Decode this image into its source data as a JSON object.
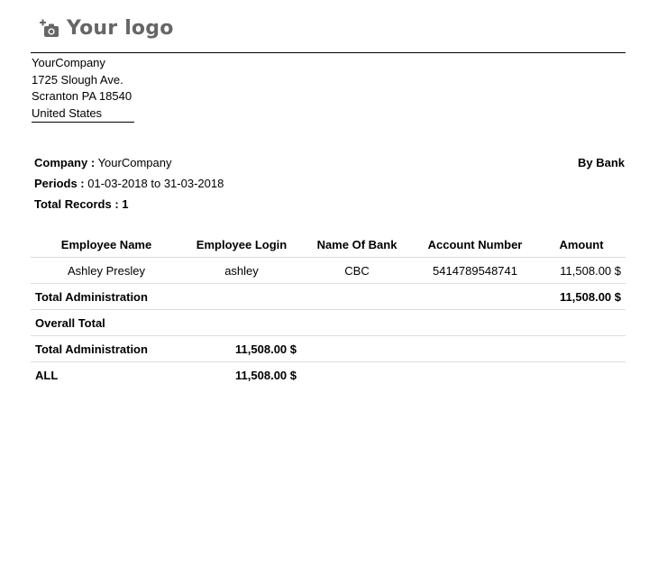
{
  "header": {
    "logo_text": "Your logo",
    "company": "YourCompany",
    "street": "1725 Slough Ave.",
    "city": "Scranton PA 18540",
    "country": "United States"
  },
  "meta": {
    "company_label": "Company :",
    "company_value": "YourCompany",
    "period_label": "Periods :",
    "period_value": "01-03-2018 to 31-03-2018",
    "records_label": "Total Records : 1",
    "by_bank": "By Bank"
  },
  "table": {
    "columns": [
      "Employee Name",
      "Employee Login",
      "Name Of Bank",
      "Account Number",
      "Amount"
    ],
    "row": {
      "name": "Ashley Presley",
      "login": "ashley",
      "bank": "CBC",
      "account": "5414789548741",
      "amount": "11,508.00 $"
    },
    "dept_total_label": "Total Administration",
    "dept_total_amount": "11,508.00 $",
    "overall_label": "Overall Total",
    "overall_dept_label": "Total Administration",
    "overall_dept_amount": "11,508.00 $",
    "all_label": "ALL",
    "all_amount": "11,508.00 $"
  }
}
